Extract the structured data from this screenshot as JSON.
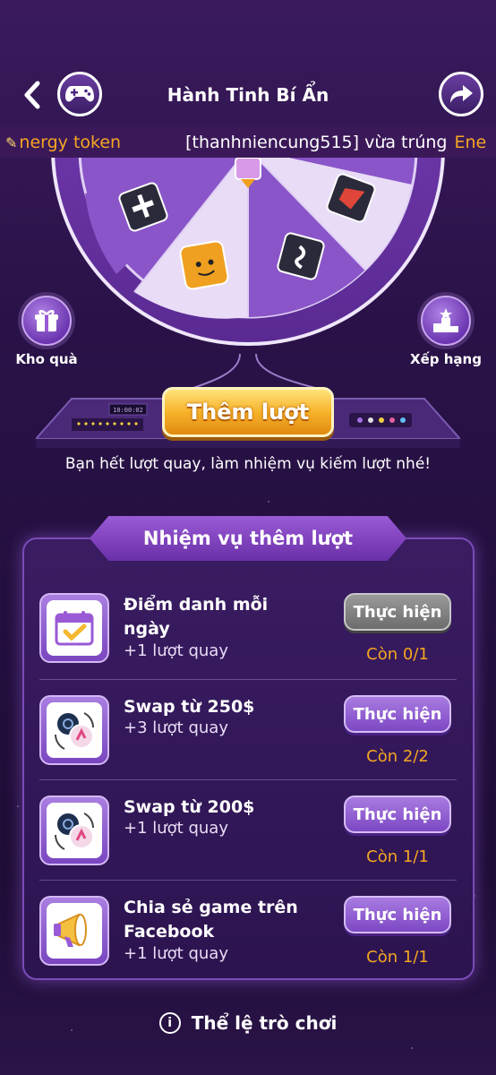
{
  "header": {
    "title": "Hành Tinh Bí Ẩn",
    "back_icon": "back-arrow-icon",
    "game_icon": "gamepad-icon",
    "share_icon": "share-arrow-icon"
  },
  "ticker": {
    "prefix": "nergy token",
    "user_text": "[thanhniencung515] vừa trúng",
    "suffix": "Ene"
  },
  "side": {
    "kho_label": "Kho quà",
    "xephang_label": "Xếp hạng"
  },
  "spin": {
    "button_label": "Thêm lượt",
    "machine_readout": "10:00:02",
    "hint": "Bạn hết lượt quay, làm nhiệm vụ kiếm lượt nhé!"
  },
  "missions": {
    "title": "Nhiệm vụ thêm lượt",
    "items": [
      {
        "name": "Điểm danh mỗi ngày",
        "reward": "+1 lượt quay",
        "button": "Thực hiện",
        "remaining": "Còn 0/1",
        "disabled": true,
        "icon": "calendar-check-icon"
      },
      {
        "name": "Swap từ 250$",
        "reward": "+3 lượt quay",
        "button": "Thực hiện",
        "remaining": "Còn 2/2",
        "disabled": false,
        "icon": "swap-coins-icon"
      },
      {
        "name": "Swap từ 200$",
        "reward": "+1 lượt quay",
        "button": "Thực hiện",
        "remaining": "Còn 1/1",
        "disabled": false,
        "icon": "swap-coins-icon"
      },
      {
        "name": "Chia sẻ game trên Facebook",
        "reward": "+1 lượt quay",
        "button": "Thực hiện",
        "remaining": "Còn 1/1",
        "disabled": false,
        "icon": "megaphone-icon"
      }
    ]
  },
  "footer": {
    "rules_label": "Thể lệ trò chơi"
  },
  "colors": {
    "accent": "#f5a623",
    "panel_border": "#7a4bb8",
    "button_purple": "#8d58d0"
  }
}
